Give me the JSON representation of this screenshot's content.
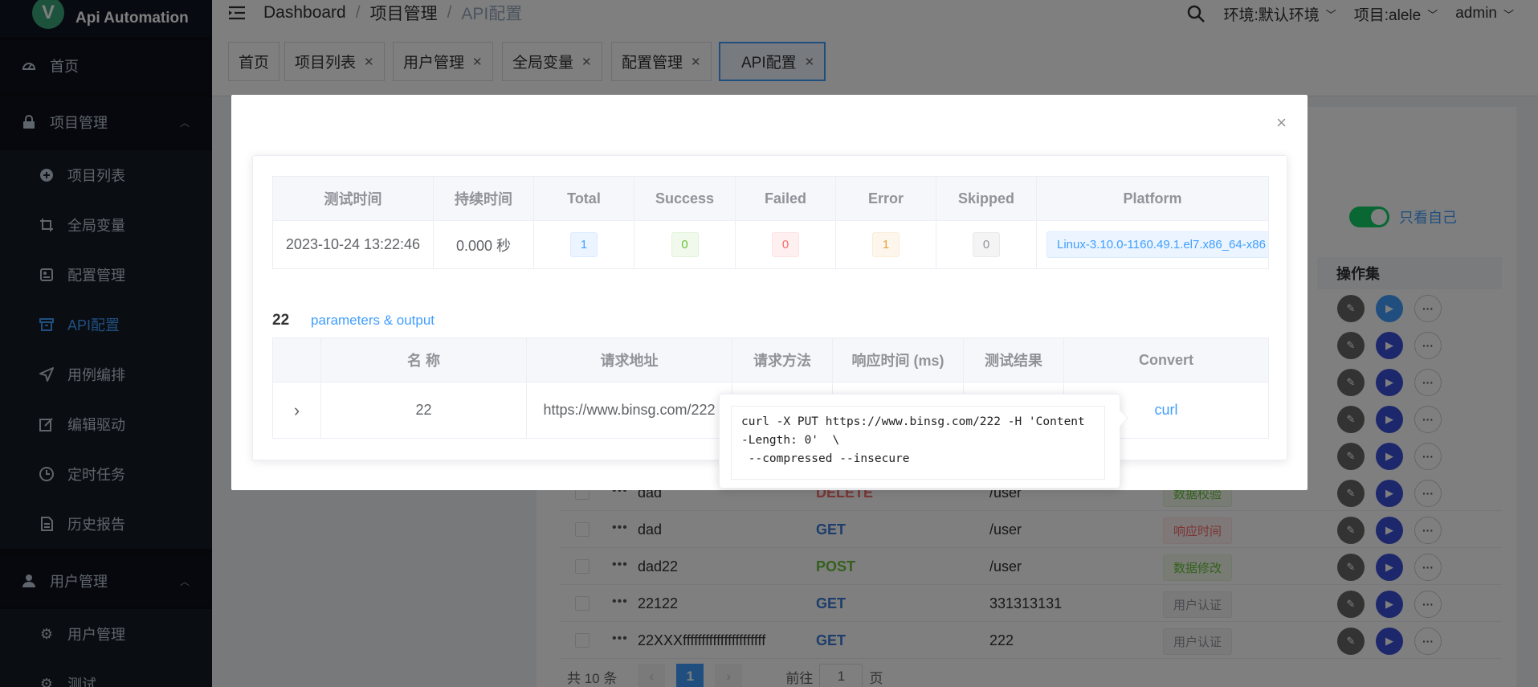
{
  "app": {
    "title": "Api Automation",
    "logo_letter": "V"
  },
  "sidebar": {
    "items": [
      {
        "label": "首页",
        "icon": "dashboard-icon",
        "level": "top"
      },
      {
        "label": "项目管理",
        "icon": "lock-icon",
        "level": "top",
        "expanded": true
      },
      {
        "label": "项目列表",
        "icon": "plus-circle-icon",
        "level": "sub"
      },
      {
        "label": "全局变量",
        "icon": "crop-icon",
        "level": "sub"
      },
      {
        "label": "配置管理",
        "icon": "settings-card-icon",
        "level": "sub"
      },
      {
        "label": "API配置",
        "icon": "box-icon",
        "level": "sub",
        "active": true
      },
      {
        "label": "用例编排",
        "icon": "send-icon",
        "level": "sub"
      },
      {
        "label": "编辑驱动",
        "icon": "edit-icon",
        "level": "sub"
      },
      {
        "label": "定时任务",
        "icon": "clock-icon",
        "level": "sub"
      },
      {
        "label": "历史报告",
        "icon": "document-icon",
        "level": "sub"
      },
      {
        "label": "用户管理",
        "icon": "user-icon",
        "level": "top",
        "expanded": true
      },
      {
        "label": "用户管理",
        "icon": "gear-icon",
        "level": "sub"
      },
      {
        "label": "测试",
        "icon": "gear-icon",
        "level": "sub"
      }
    ]
  },
  "header": {
    "breadcrumb": [
      "Dashboard",
      "项目管理",
      "API配置"
    ],
    "env": "环境:默认环境",
    "project": "项目:alele",
    "user": "admin"
  },
  "tags": [
    {
      "label": "首页",
      "closable": false
    },
    {
      "label": "项目列表",
      "closable": true
    },
    {
      "label": "用户管理",
      "closable": true
    },
    {
      "label": "全局变量",
      "closable": true
    },
    {
      "label": "配置管理",
      "closable": true
    },
    {
      "label": "API配置",
      "closable": true,
      "active": true
    }
  ],
  "background": {
    "only_me": "只看自己",
    "ops_header": "操作集",
    "rows": [
      {
        "name": "dad",
        "method": "DELETE",
        "method_color": "#f56c6c",
        "path": "/user",
        "badge": "数据校验",
        "badge_style": "g"
      },
      {
        "name": "dad",
        "method": "GET",
        "method_color": "#3a7bd5",
        "path": "/user",
        "badge": "响应时间",
        "badge_style": "r"
      },
      {
        "name": "dad22",
        "method": "POST",
        "method_color": "#67c23a",
        "path": "/user",
        "badge": "数据修改",
        "badge_style": "g"
      },
      {
        "name": "22122",
        "method": "GET",
        "method_color": "#3a7bd5",
        "path": "331313131",
        "badge": "用户认证",
        "badge_style": "s"
      },
      {
        "name": "22XXXffffffffffffffffffffff",
        "method": "GET",
        "method_color": "#3a7bd5",
        "path": "222",
        "badge": "用户认证",
        "badge_style": "s"
      }
    ],
    "pager": {
      "total": "共 10 条",
      "current": "1",
      "goto": "前往",
      "page_input": "1",
      "page_suffix": "页",
      "prev": "‹",
      "next": "›"
    }
  },
  "dialog": {
    "close": "×",
    "summary": {
      "headers": [
        "测试时间",
        "持续时间",
        "Total",
        "Success",
        "Failed",
        "Error",
        "Skipped",
        "Platform"
      ],
      "row": {
        "time": "2023-10-24 13:22:46",
        "duration": "0.000 秒",
        "total": "1",
        "success": "0",
        "failed": "0",
        "error": "1",
        "skipped": "0",
        "platform": "Linux-3.10.0-1160.49.1.el7.x86_64-x86"
      }
    },
    "section": {
      "name": "22",
      "link": "parameters & output"
    },
    "detail": {
      "headers": [
        "",
        "名 称",
        "请求地址",
        "请求方法",
        "响应时间 (ms)",
        "测试结果",
        "Convert"
      ],
      "row": {
        "expand": "›",
        "name": "22",
        "url": "https://www.binsg.com/222",
        "convert": "curl"
      }
    },
    "popover": {
      "text": "curl -X PUT https://www.binsg.com/222 -H 'Content\n-Length: 0'  \\\n --compressed --insecure"
    }
  },
  "colors": {
    "accent": "#409eff",
    "sidebar_bg": "#0a0e17",
    "success": "#13ce66"
  }
}
